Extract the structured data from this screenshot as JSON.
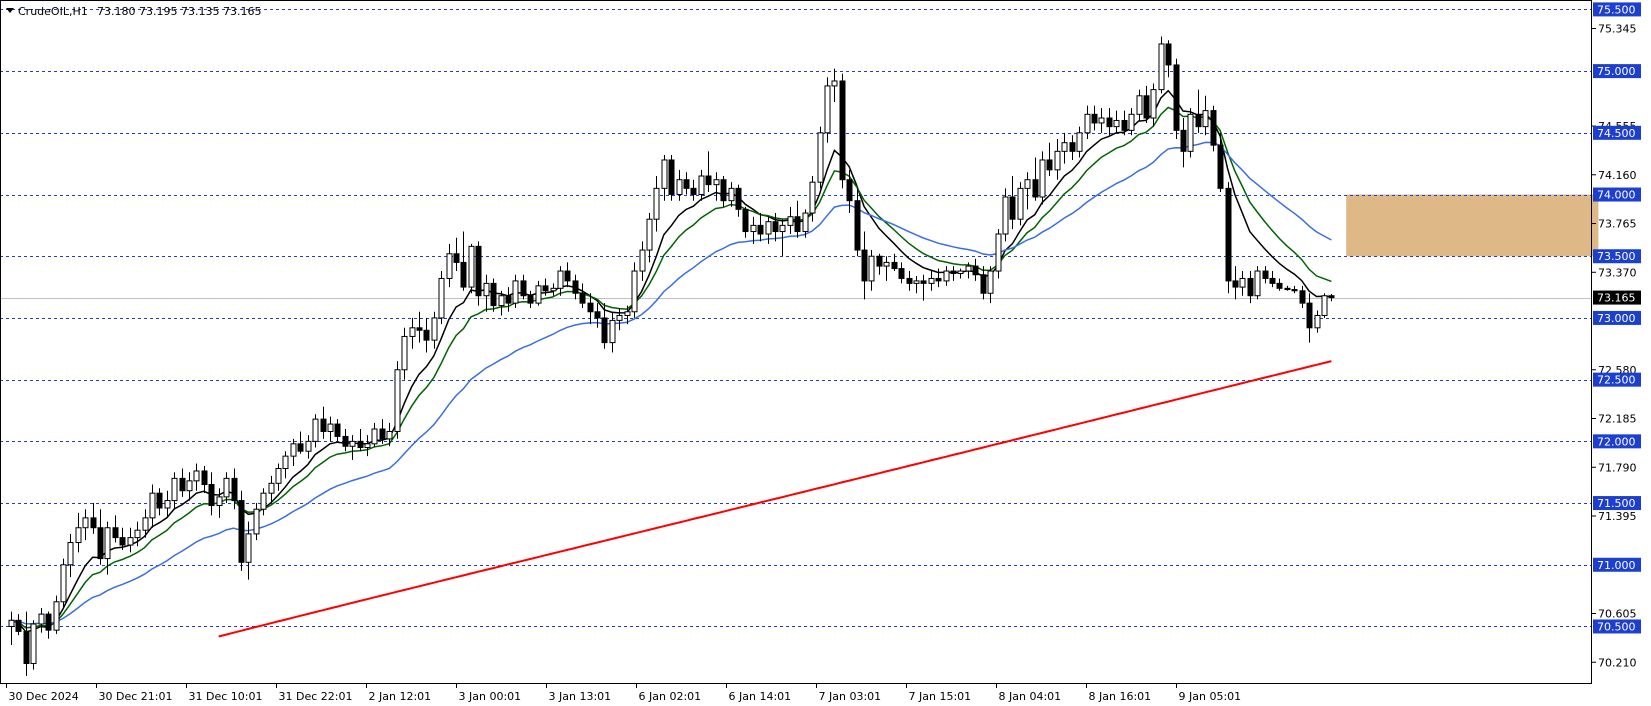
{
  "header": {
    "symbol_timeframe": "CrudeOIL,H1",
    "ohlc": "73.180 73.195 73.135 73.165"
  },
  "colors": {
    "background": "#ffffff",
    "frame": "#000000",
    "level_line": "#1c3fcf",
    "level_label_bg": "#1c3fcf",
    "level_label_text": "#ffffff",
    "price_label_bg": "#000000",
    "price_label_text": "#ffffff",
    "current_price_line": "#c0c0c0",
    "bull_candle_fill": "#ffffff",
    "bear_candle_fill": "#000000",
    "candle_outline": "#000000",
    "zone_fill": "#deb887"
  },
  "chart_data": {
    "type": "candlestick",
    "symbol": "CrudeOIL",
    "timeframe": "H1",
    "ylim": [
      70.05,
      75.56
    ],
    "grid": false,
    "price_scale_labels": [
      "75.345",
      "74.555",
      "74.160",
      "73.765",
      "73.370",
      "72.580",
      "72.185",
      "71.790",
      "71.395",
      "70.605",
      "70.210"
    ],
    "horizontal_levels": [
      {
        "label": "75.500",
        "value": 75.5
      },
      {
        "label": "75.000",
        "value": 75.0
      },
      {
        "label": "74.500",
        "value": 74.5
      },
      {
        "label": "74.000",
        "value": 74.0
      },
      {
        "label": "73.500",
        "value": 73.5
      },
      {
        "label": "73.000",
        "value": 73.0
      },
      {
        "label": "72.500",
        "value": 72.5
      },
      {
        "label": "72.000",
        "value": 72.0
      },
      {
        "label": "71.500",
        "value": 71.5
      },
      {
        "label": "71.000",
        "value": 71.0
      },
      {
        "label": "70.500",
        "value": 70.5
      }
    ],
    "current_price": {
      "label": "73.165",
      "value": 73.165
    },
    "time_labels": [
      "30 Dec 2024",
      "30 Dec 21:01",
      "31 Dec 10:01",
      "31 Dec 22:01",
      "2 Jan 12:01",
      "3 Jan 00:01",
      "3 Jan 13:01",
      "6 Jan 02:01",
      "6 Jan 14:01",
      "7 Jan 03:01",
      "7 Jan 15:01",
      "8 Jan 04:01",
      "8 Jan 16:01",
      "9 Jan 05:01"
    ],
    "zone": {
      "y_from": 73.5,
      "y_to": 74.0,
      "x_from_bar": 180,
      "x_to_bar": 214
    },
    "candles": [
      {
        "o": 70.5,
        "h": 70.62,
        "l": 70.35,
        "c": 70.55
      },
      {
        "o": 70.55,
        "h": 70.6,
        "l": 70.43,
        "c": 70.46
      },
      {
        "o": 70.46,
        "h": 70.62,
        "l": 70.1,
        "c": 70.2
      },
      {
        "o": 70.2,
        "h": 70.55,
        "l": 70.15,
        "c": 70.52
      },
      {
        "o": 70.52,
        "h": 70.65,
        "l": 70.45,
        "c": 70.6
      },
      {
        "o": 70.6,
        "h": 70.62,
        "l": 70.4,
        "c": 70.47
      },
      {
        "o": 70.47,
        "h": 70.75,
        "l": 70.44,
        "c": 70.7
      },
      {
        "o": 70.7,
        "h": 71.05,
        "l": 70.65,
        "c": 71.0
      },
      {
        "o": 71.0,
        "h": 71.25,
        "l": 70.9,
        "c": 71.18
      },
      {
        "o": 71.18,
        "h": 71.42,
        "l": 71.1,
        "c": 71.3
      },
      {
        "o": 71.3,
        "h": 71.45,
        "l": 71.2,
        "c": 71.38
      },
      {
        "o": 71.38,
        "h": 71.5,
        "l": 71.25,
        "c": 71.3
      },
      {
        "o": 71.3,
        "h": 71.45,
        "l": 71.0,
        "c": 71.05
      },
      {
        "o": 71.05,
        "h": 71.35,
        "l": 70.92,
        "c": 71.3
      },
      {
        "o": 71.3,
        "h": 71.4,
        "l": 71.18,
        "c": 71.22
      },
      {
        "o": 71.22,
        "h": 71.3,
        "l": 71.12,
        "c": 71.16
      },
      {
        "o": 71.16,
        "h": 71.3,
        "l": 71.1,
        "c": 71.22
      },
      {
        "o": 71.22,
        "h": 71.35,
        "l": 71.15,
        "c": 71.28
      },
      {
        "o": 71.28,
        "h": 71.45,
        "l": 71.22,
        "c": 71.38
      },
      {
        "o": 71.38,
        "h": 71.65,
        "l": 71.3,
        "c": 71.58
      },
      {
        "o": 71.58,
        "h": 71.62,
        "l": 71.4,
        "c": 71.46
      },
      {
        "o": 71.46,
        "h": 71.6,
        "l": 71.38,
        "c": 71.52
      },
      {
        "o": 71.52,
        "h": 71.75,
        "l": 71.45,
        "c": 71.7
      },
      {
        "o": 71.7,
        "h": 71.78,
        "l": 71.55,
        "c": 71.6
      },
      {
        "o": 71.6,
        "h": 71.75,
        "l": 71.52,
        "c": 71.68
      },
      {
        "o": 71.68,
        "h": 71.82,
        "l": 71.6,
        "c": 71.76
      },
      {
        "o": 71.76,
        "h": 71.8,
        "l": 71.58,
        "c": 71.65
      },
      {
        "o": 71.65,
        "h": 71.75,
        "l": 71.4,
        "c": 71.48
      },
      {
        "o": 71.48,
        "h": 71.62,
        "l": 71.38,
        "c": 71.55
      },
      {
        "o": 71.55,
        "h": 71.75,
        "l": 71.5,
        "c": 71.7
      },
      {
        "o": 71.7,
        "h": 71.78,
        "l": 71.45,
        "c": 71.52
      },
      {
        "o": 71.52,
        "h": 71.6,
        "l": 70.95,
        "c": 71.02
      },
      {
        "o": 71.02,
        "h": 71.35,
        "l": 70.88,
        "c": 71.25
      },
      {
        "o": 71.25,
        "h": 71.5,
        "l": 71.2,
        "c": 71.45
      },
      {
        "o": 71.45,
        "h": 71.62,
        "l": 71.4,
        "c": 71.58
      },
      {
        "o": 71.58,
        "h": 71.72,
        "l": 71.5,
        "c": 71.66
      },
      {
        "o": 71.66,
        "h": 71.82,
        "l": 71.6,
        "c": 71.78
      },
      {
        "o": 71.78,
        "h": 71.92,
        "l": 71.7,
        "c": 71.88
      },
      {
        "o": 71.88,
        "h": 72.02,
        "l": 71.8,
        "c": 71.98
      },
      {
        "o": 71.98,
        "h": 72.08,
        "l": 71.9,
        "c": 71.92
      },
      {
        "o": 71.92,
        "h": 72.05,
        "l": 71.86,
        "c": 72.0
      },
      {
        "o": 72.0,
        "h": 72.22,
        "l": 71.95,
        "c": 72.18
      },
      {
        "o": 72.18,
        "h": 72.28,
        "l": 72.02,
        "c": 72.08
      },
      {
        "o": 72.08,
        "h": 72.2,
        "l": 72.0,
        "c": 72.14
      },
      {
        "o": 72.14,
        "h": 72.18,
        "l": 72.0,
        "c": 72.04
      },
      {
        "o": 72.04,
        "h": 72.1,
        "l": 71.92,
        "c": 71.96
      },
      {
        "o": 71.96,
        "h": 72.05,
        "l": 71.85,
        "c": 72.0
      },
      {
        "o": 72.0,
        "h": 72.1,
        "l": 71.92,
        "c": 71.95
      },
      {
        "o": 71.95,
        "h": 72.05,
        "l": 71.88,
        "c": 71.98
      },
      {
        "o": 71.98,
        "h": 72.15,
        "l": 71.95,
        "c": 72.1
      },
      {
        "o": 72.1,
        "h": 72.18,
        "l": 71.98,
        "c": 72.02
      },
      {
        "o": 72.02,
        "h": 72.15,
        "l": 71.96,
        "c": 72.08
      },
      {
        "o": 72.08,
        "h": 72.65,
        "l": 72.02,
        "c": 72.58
      },
      {
        "o": 72.58,
        "h": 72.92,
        "l": 72.5,
        "c": 72.85
      },
      {
        "o": 72.85,
        "h": 73.0,
        "l": 72.75,
        "c": 72.92
      },
      {
        "o": 72.92,
        "h": 73.05,
        "l": 72.8,
        "c": 72.9
      },
      {
        "o": 72.9,
        "h": 73.0,
        "l": 72.72,
        "c": 72.82
      },
      {
        "o": 72.82,
        "h": 73.05,
        "l": 72.75,
        "c": 73.0
      },
      {
        "o": 73.0,
        "h": 73.38,
        "l": 72.95,
        "c": 73.32
      },
      {
        "o": 73.32,
        "h": 73.6,
        "l": 73.25,
        "c": 73.52
      },
      {
        "o": 73.52,
        "h": 73.65,
        "l": 73.38,
        "c": 73.45
      },
      {
        "o": 73.45,
        "h": 73.7,
        "l": 73.22,
        "c": 73.25
      },
      {
        "o": 73.25,
        "h": 73.6,
        "l": 73.2,
        "c": 73.58
      },
      {
        "o": 73.58,
        "h": 73.62,
        "l": 73.1,
        "c": 73.18
      },
      {
        "o": 73.18,
        "h": 73.35,
        "l": 73.05,
        "c": 73.28
      },
      {
        "o": 73.28,
        "h": 73.32,
        "l": 73.05,
        "c": 73.1
      },
      {
        "o": 73.1,
        "h": 73.22,
        "l": 73.02,
        "c": 73.18
      },
      {
        "o": 73.18,
        "h": 73.25,
        "l": 73.05,
        "c": 73.12
      },
      {
        "o": 73.12,
        "h": 73.35,
        "l": 73.08,
        "c": 73.3
      },
      {
        "o": 73.3,
        "h": 73.35,
        "l": 73.15,
        "c": 73.18
      },
      {
        "o": 73.18,
        "h": 73.22,
        "l": 73.08,
        "c": 73.12
      },
      {
        "o": 73.12,
        "h": 73.3,
        "l": 73.1,
        "c": 73.26
      },
      {
        "o": 73.26,
        "h": 73.32,
        "l": 73.18,
        "c": 73.22
      },
      {
        "o": 73.22,
        "h": 73.28,
        "l": 73.18,
        "c": 73.24
      },
      {
        "o": 73.24,
        "h": 73.42,
        "l": 73.18,
        "c": 73.38
      },
      {
        "o": 73.38,
        "h": 73.45,
        "l": 73.25,
        "c": 73.3
      },
      {
        "o": 73.3,
        "h": 73.35,
        "l": 73.15,
        "c": 73.2
      },
      {
        "o": 73.2,
        "h": 73.28,
        "l": 73.08,
        "c": 73.12
      },
      {
        "o": 73.12,
        "h": 73.2,
        "l": 72.95,
        "c": 73.05
      },
      {
        "o": 73.05,
        "h": 73.12,
        "l": 72.92,
        "c": 73.0
      },
      {
        "o": 73.0,
        "h": 73.12,
        "l": 72.75,
        "c": 72.8
      },
      {
        "o": 72.8,
        "h": 73.05,
        "l": 72.72,
        "c": 72.98
      },
      {
        "o": 72.98,
        "h": 73.08,
        "l": 72.9,
        "c": 73.02
      },
      {
        "o": 73.02,
        "h": 73.1,
        "l": 72.95,
        "c": 73.05
      },
      {
        "o": 73.05,
        "h": 73.45,
        "l": 73.0,
        "c": 73.38
      },
      {
        "o": 73.38,
        "h": 73.62,
        "l": 73.3,
        "c": 73.55
      },
      {
        "o": 73.55,
        "h": 73.85,
        "l": 73.45,
        "c": 73.8
      },
      {
        "o": 73.8,
        "h": 74.15,
        "l": 73.7,
        "c": 74.05
      },
      {
        "o": 74.05,
        "h": 74.32,
        "l": 73.95,
        "c": 74.28
      },
      {
        "o": 74.28,
        "h": 74.32,
        "l": 73.95,
        "c": 74.0
      },
      {
        "o": 74.0,
        "h": 74.2,
        "l": 73.95,
        "c": 74.12
      },
      {
        "o": 74.12,
        "h": 74.18,
        "l": 74.0,
        "c": 74.05
      },
      {
        "o": 74.05,
        "h": 74.12,
        "l": 73.95,
        "c": 74.0
      },
      {
        "o": 74.0,
        "h": 74.2,
        "l": 73.95,
        "c": 74.15
      },
      {
        "o": 74.15,
        "h": 74.35,
        "l": 74.02,
        "c": 74.08
      },
      {
        "o": 74.08,
        "h": 74.18,
        "l": 73.95,
        "c": 74.12
      },
      {
        "o": 74.12,
        "h": 74.15,
        "l": 73.9,
        "c": 73.95
      },
      {
        "o": 73.95,
        "h": 74.1,
        "l": 73.9,
        "c": 74.05
      },
      {
        "o": 74.05,
        "h": 74.08,
        "l": 73.82,
        "c": 73.88
      },
      {
        "o": 73.88,
        "h": 73.9,
        "l": 73.65,
        "c": 73.7
      },
      {
        "o": 73.7,
        "h": 73.82,
        "l": 73.6,
        "c": 73.75
      },
      {
        "o": 73.75,
        "h": 73.85,
        "l": 73.62,
        "c": 73.68
      },
      {
        "o": 73.68,
        "h": 73.82,
        "l": 73.6,
        "c": 73.78
      },
      {
        "o": 73.78,
        "h": 73.85,
        "l": 73.62,
        "c": 73.7
      },
      {
        "o": 73.7,
        "h": 73.8,
        "l": 73.5,
        "c": 73.75
      },
      {
        "o": 73.75,
        "h": 73.9,
        "l": 73.68,
        "c": 73.82
      },
      {
        "o": 73.82,
        "h": 73.95,
        "l": 73.65,
        "c": 73.7
      },
      {
        "o": 73.7,
        "h": 73.88,
        "l": 73.65,
        "c": 73.85
      },
      {
        "o": 73.85,
        "h": 74.15,
        "l": 73.78,
        "c": 74.1
      },
      {
        "o": 74.1,
        "h": 74.55,
        "l": 74.05,
        "c": 74.5
      },
      {
        "o": 74.5,
        "h": 74.95,
        "l": 74.42,
        "c": 74.88
      },
      {
        "o": 74.88,
        "h": 75.02,
        "l": 74.75,
        "c": 74.92
      },
      {
        "o": 74.92,
        "h": 74.98,
        "l": 74.05,
        "c": 74.12
      },
      {
        "o": 74.12,
        "h": 74.2,
        "l": 73.85,
        "c": 73.95
      },
      {
        "o": 73.95,
        "h": 74.05,
        "l": 73.5,
        "c": 73.55
      },
      {
        "o": 73.55,
        "h": 73.7,
        "l": 73.15,
        "c": 73.3
      },
      {
        "o": 73.3,
        "h": 73.55,
        "l": 73.22,
        "c": 73.5
      },
      {
        "o": 73.5,
        "h": 73.52,
        "l": 73.35,
        "c": 73.42
      },
      {
        "o": 73.42,
        "h": 73.5,
        "l": 73.3,
        "c": 73.45
      },
      {
        "o": 73.45,
        "h": 73.52,
        "l": 73.38,
        "c": 73.4
      },
      {
        "o": 73.4,
        "h": 73.45,
        "l": 73.28,
        "c": 73.32
      },
      {
        "o": 73.32,
        "h": 73.38,
        "l": 73.22,
        "c": 73.28
      },
      {
        "o": 73.28,
        "h": 73.34,
        "l": 73.2,
        "c": 73.3
      },
      {
        "o": 73.3,
        "h": 73.35,
        "l": 73.14,
        "c": 73.28
      },
      {
        "o": 73.28,
        "h": 73.38,
        "l": 73.22,
        "c": 73.32
      },
      {
        "o": 73.32,
        "h": 73.4,
        "l": 73.25,
        "c": 73.3
      },
      {
        "o": 73.3,
        "h": 73.42,
        "l": 73.26,
        "c": 73.38
      },
      {
        "o": 73.38,
        "h": 73.42,
        "l": 73.3,
        "c": 73.36
      },
      {
        "o": 73.36,
        "h": 73.4,
        "l": 73.32,
        "c": 73.38
      },
      {
        "o": 73.38,
        "h": 73.45,
        "l": 73.32,
        "c": 73.42
      },
      {
        "o": 73.42,
        "h": 73.48,
        "l": 73.3,
        "c": 73.35
      },
      {
        "o": 73.35,
        "h": 73.42,
        "l": 73.15,
        "c": 73.2
      },
      {
        "o": 73.2,
        "h": 73.42,
        "l": 73.12,
        "c": 73.38
      },
      {
        "o": 73.38,
        "h": 73.72,
        "l": 73.32,
        "c": 73.68
      },
      {
        "o": 73.68,
        "h": 74.05,
        "l": 73.62,
        "c": 73.98
      },
      {
        "o": 73.98,
        "h": 74.15,
        "l": 73.72,
        "c": 73.8
      },
      {
        "o": 73.8,
        "h": 74.1,
        "l": 73.75,
        "c": 74.05
      },
      {
        "o": 74.05,
        "h": 74.18,
        "l": 73.88,
        "c": 74.12
      },
      {
        "o": 74.12,
        "h": 74.3,
        "l": 73.95,
        "c": 73.98
      },
      {
        "o": 73.98,
        "h": 74.35,
        "l": 73.92,
        "c": 74.28
      },
      {
        "o": 74.28,
        "h": 74.42,
        "l": 74.15,
        "c": 74.2
      },
      {
        "o": 74.2,
        "h": 74.45,
        "l": 74.12,
        "c": 74.35
      },
      {
        "o": 74.35,
        "h": 74.5,
        "l": 74.25,
        "c": 74.42
      },
      {
        "o": 74.42,
        "h": 74.48,
        "l": 74.28,
        "c": 74.35
      },
      {
        "o": 74.35,
        "h": 74.55,
        "l": 74.3,
        "c": 74.5
      },
      {
        "o": 74.5,
        "h": 74.72,
        "l": 74.45,
        "c": 74.65
      },
      {
        "o": 74.65,
        "h": 74.72,
        "l": 74.52,
        "c": 74.58
      },
      {
        "o": 74.58,
        "h": 74.7,
        "l": 74.5,
        "c": 74.62
      },
      {
        "o": 74.62,
        "h": 74.7,
        "l": 74.48,
        "c": 74.55
      },
      {
        "o": 74.55,
        "h": 74.68,
        "l": 74.5,
        "c": 74.6
      },
      {
        "o": 74.6,
        "h": 74.68,
        "l": 74.48,
        "c": 74.52
      },
      {
        "o": 74.52,
        "h": 74.7,
        "l": 74.48,
        "c": 74.65
      },
      {
        "o": 74.65,
        "h": 74.85,
        "l": 74.6,
        "c": 74.8
      },
      {
        "o": 74.8,
        "h": 74.88,
        "l": 74.58,
        "c": 74.62
      },
      {
        "o": 74.62,
        "h": 74.9,
        "l": 74.55,
        "c": 74.85
      },
      {
        "o": 74.85,
        "h": 75.28,
        "l": 74.82,
        "c": 75.22
      },
      {
        "o": 75.22,
        "h": 75.25,
        "l": 74.95,
        "c": 75.05
      },
      {
        "o": 75.05,
        "h": 75.1,
        "l": 74.45,
        "c": 74.52
      },
      {
        "o": 74.52,
        "h": 74.62,
        "l": 74.22,
        "c": 74.35
      },
      {
        "o": 74.35,
        "h": 74.7,
        "l": 74.3,
        "c": 74.65
      },
      {
        "o": 74.65,
        "h": 74.85,
        "l": 74.5,
        "c": 74.55
      },
      {
        "o": 74.55,
        "h": 74.8,
        "l": 74.48,
        "c": 74.68
      },
      {
        "o": 74.68,
        "h": 74.72,
        "l": 74.35,
        "c": 74.4
      },
      {
        "o": 74.4,
        "h": 74.5,
        "l": 74.02,
        "c": 74.05
      },
      {
        "o": 74.05,
        "h": 74.1,
        "l": 73.2,
        "c": 73.3
      },
      {
        "o": 73.3,
        "h": 73.42,
        "l": 73.15,
        "c": 73.25
      },
      {
        "o": 73.25,
        "h": 73.38,
        "l": 73.18,
        "c": 73.32
      },
      {
        "o": 73.32,
        "h": 73.38,
        "l": 73.12,
        "c": 73.18
      },
      {
        "o": 73.18,
        "h": 73.42,
        "l": 73.15,
        "c": 73.38
      },
      {
        "o": 73.38,
        "h": 73.42,
        "l": 73.28,
        "c": 73.32
      },
      {
        "o": 73.32,
        "h": 73.38,
        "l": 73.25,
        "c": 73.28
      },
      {
        "o": 73.28,
        "h": 73.32,
        "l": 73.22,
        "c": 73.24
      },
      {
        "o": 73.24,
        "h": 73.26,
        "l": 73.22,
        "c": 73.23
      },
      {
        "o": 73.23,
        "h": 73.26,
        "l": 73.2,
        "c": 73.22
      },
      {
        "o": 73.22,
        "h": 73.26,
        "l": 73.08,
        "c": 73.12
      },
      {
        "o": 73.12,
        "h": 73.2,
        "l": 72.8,
        "c": 72.92
      },
      {
        "o": 72.92,
        "h": 73.06,
        "l": 72.88,
        "c": 73.02
      },
      {
        "o": 73.02,
        "h": 73.2,
        "l": 73.0,
        "c": 73.18
      },
      {
        "o": 73.18,
        "h": 73.195,
        "l": 73.135,
        "c": 73.165
      }
    ],
    "series": [
      {
        "kind": "ma",
        "color": "#000000",
        "period": 8
      },
      {
        "kind": "ma",
        "color": "#006400",
        "period": 13
      },
      {
        "kind": "ma",
        "color": "#3a6fe0",
        "period": 30
      },
      {
        "kind": "ma",
        "color": "#ff0000",
        "period": 200
      }
    ]
  }
}
